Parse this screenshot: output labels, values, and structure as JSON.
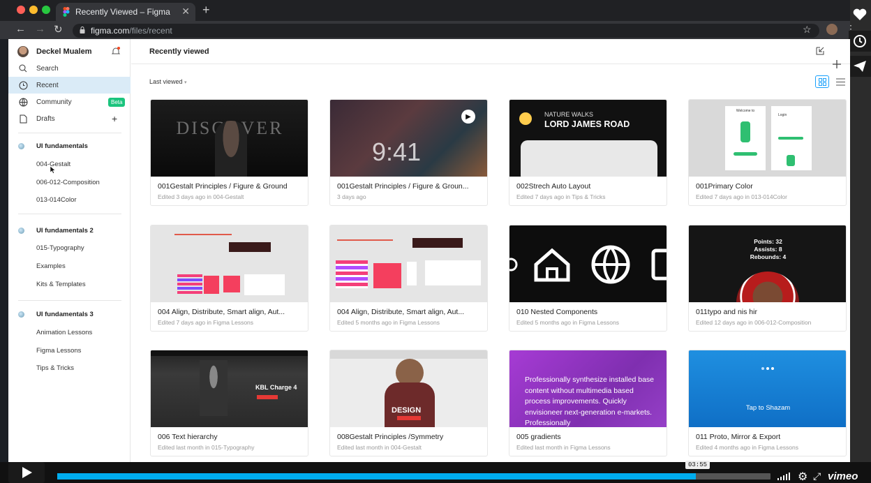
{
  "browser": {
    "tab_title": "Recently Viewed – Figma",
    "url_host": "figma.com",
    "url_path": "/files/recent"
  },
  "sidebar": {
    "user_name": "Deckel Mualem",
    "nav": [
      {
        "label": "Search",
        "icon": "search-icon"
      },
      {
        "label": "Recent",
        "icon": "clock-icon"
      },
      {
        "label": "Community",
        "icon": "globe-icon"
      },
      {
        "label": "Drafts",
        "icon": "file-icon"
      }
    ],
    "community_badge": "Beta",
    "projects": [
      {
        "name": "UI fundamentals",
        "files": [
          "004-Gestalt",
          "006-012-Composition",
          "013-014Color"
        ]
      },
      {
        "name": "UI fundamentals 2",
        "files": [
          "015-Typography",
          "Examples",
          "Kits & Templates"
        ]
      },
      {
        "name": "UI fundamentals 3",
        "files": [
          "Animation Lessons",
          "Figma Lessons",
          "Tips & Tricks"
        ]
      }
    ]
  },
  "main": {
    "title": "Recently viewed",
    "sort_label": "Last viewed",
    "files": [
      {
        "title": "001Gestalt Principles / Figure & Ground",
        "sub": "Edited 3 days ago in 004-Gestalt",
        "thumb_text": "DISCOVER"
      },
      {
        "title": "001Gestalt Principles / Figure & Groun...",
        "sub": "3 days ago",
        "thumb_text": "9:41"
      },
      {
        "title": "002Strech Auto Layout",
        "sub": "Edited 7 days ago in Tips & Tricks",
        "thumb_text": "NATURE WALKS",
        "thumb_text2": "LORD JAMES ROAD"
      },
      {
        "title": "001Primary Color",
        "sub": "Edited 7 days ago in 013-014Color",
        "thumb_text": "Welcome to",
        "thumb_text2": "Login"
      },
      {
        "title": "004 Align, Distribute, Smart align, Aut...",
        "sub": "Edited 7 days ago in Figma Lessons"
      },
      {
        "title": "004 Align, Distribute, Smart align, Aut...",
        "sub": "Edited 5 months ago in Figma Lessons"
      },
      {
        "title": "010 Nested Components",
        "sub": "Edited 5 months ago in Figma Lessons"
      },
      {
        "title": "011typo and nis hir",
        "sub": "Edited 12 days ago in 006-012-Composition",
        "thumb_text": "Points: 32",
        "thumb_text2": "Assists: 8",
        "thumb_text3": "Rebounds: 4"
      },
      {
        "title": "006 Text hierarchy",
        "sub": "Edited last month in 015-Typography",
        "thumb_text": "KBL Charge 4"
      },
      {
        "title": "008Gestalt Principles /Symmetry",
        "sub": "Edited last month in 004-Gestalt",
        "thumb_text": "DESIGN"
      },
      {
        "title": "005 gradients",
        "sub": "Edited last month in Figma Lessons",
        "thumb_text": "Professionally synthesize installed base content without multimedia based process improvements. Quickly envisioneer next-generation e-markets. Professionally"
      },
      {
        "title": "011 Proto, Mirror & Export",
        "sub": "Edited 4 months ago in Figma Lessons",
        "thumb_text": "Tap to Shazam"
      }
    ]
  },
  "player": {
    "time": "03:55",
    "progress": 0.895,
    "brand": "vimeo"
  }
}
